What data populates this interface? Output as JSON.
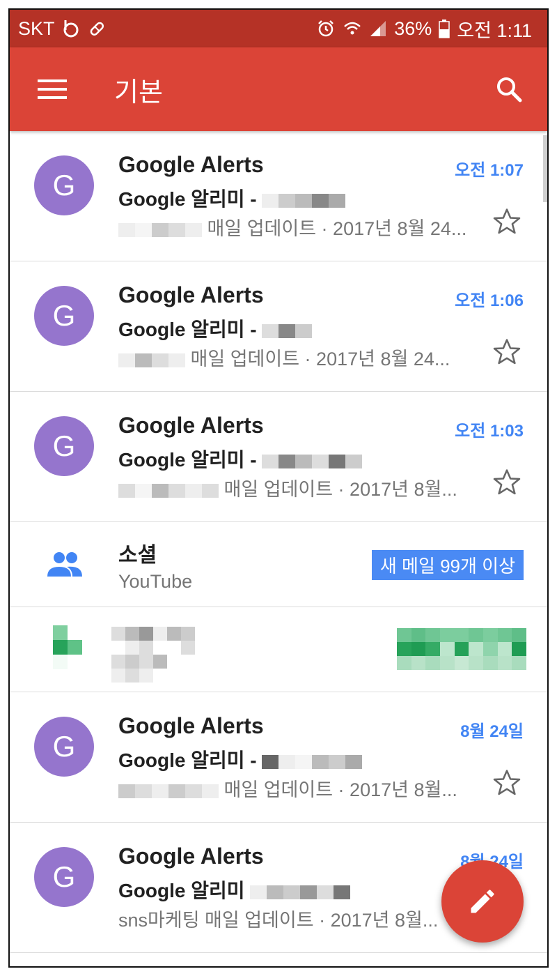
{
  "status_bar": {
    "carrier": "SKT",
    "battery": "36%",
    "time": "오전 1:11"
  },
  "app_bar": {
    "title": "기본",
    "menu_icon": "hamburger-menu-icon",
    "search_icon": "search-icon"
  },
  "emails": [
    {
      "avatar_letter": "G",
      "sender": "Google Alerts",
      "time": "오전 1:07",
      "subject": "Google 알리미 -",
      "snippet": "매일 업데이트 · 2017년 8월 24..."
    },
    {
      "avatar_letter": "G",
      "sender": "Google Alerts",
      "time": "오전 1:06",
      "subject": "Google 알리미 -",
      "snippet": "매일 업데이트 · 2017년 8월 24..."
    },
    {
      "avatar_letter": "G",
      "sender": "Google Alerts",
      "time": "오전 1:03",
      "subject": "Google 알리미 -",
      "snippet": "매일 업데이트 · 2017년 8월..."
    }
  ],
  "social": {
    "title": "소셜",
    "subtitle": "YouTube",
    "badge": "새 메일 99개 이상",
    "icon": "people-icon"
  },
  "emails_after": [
    {
      "avatar_letter": "G",
      "sender": "Google Alerts",
      "time": "8월 24일",
      "subject": "Google 알리미 -",
      "snippet": "매일 업데이트 · 2017년 8월..."
    },
    {
      "avatar_letter": "G",
      "sender": "Google Alerts",
      "time": "8월 24일",
      "subject": "Google 알리미",
      "snippet": "sns마케팅 매일 업데이트 · 2017년 8월..."
    }
  ],
  "fab": {
    "icon": "pencil-icon"
  },
  "colors": {
    "status_bar": "#b53226",
    "app_bar": "#db4437",
    "avatar": "#9575cd",
    "accent_blue": "#4285f4",
    "fab": "#db4437"
  }
}
